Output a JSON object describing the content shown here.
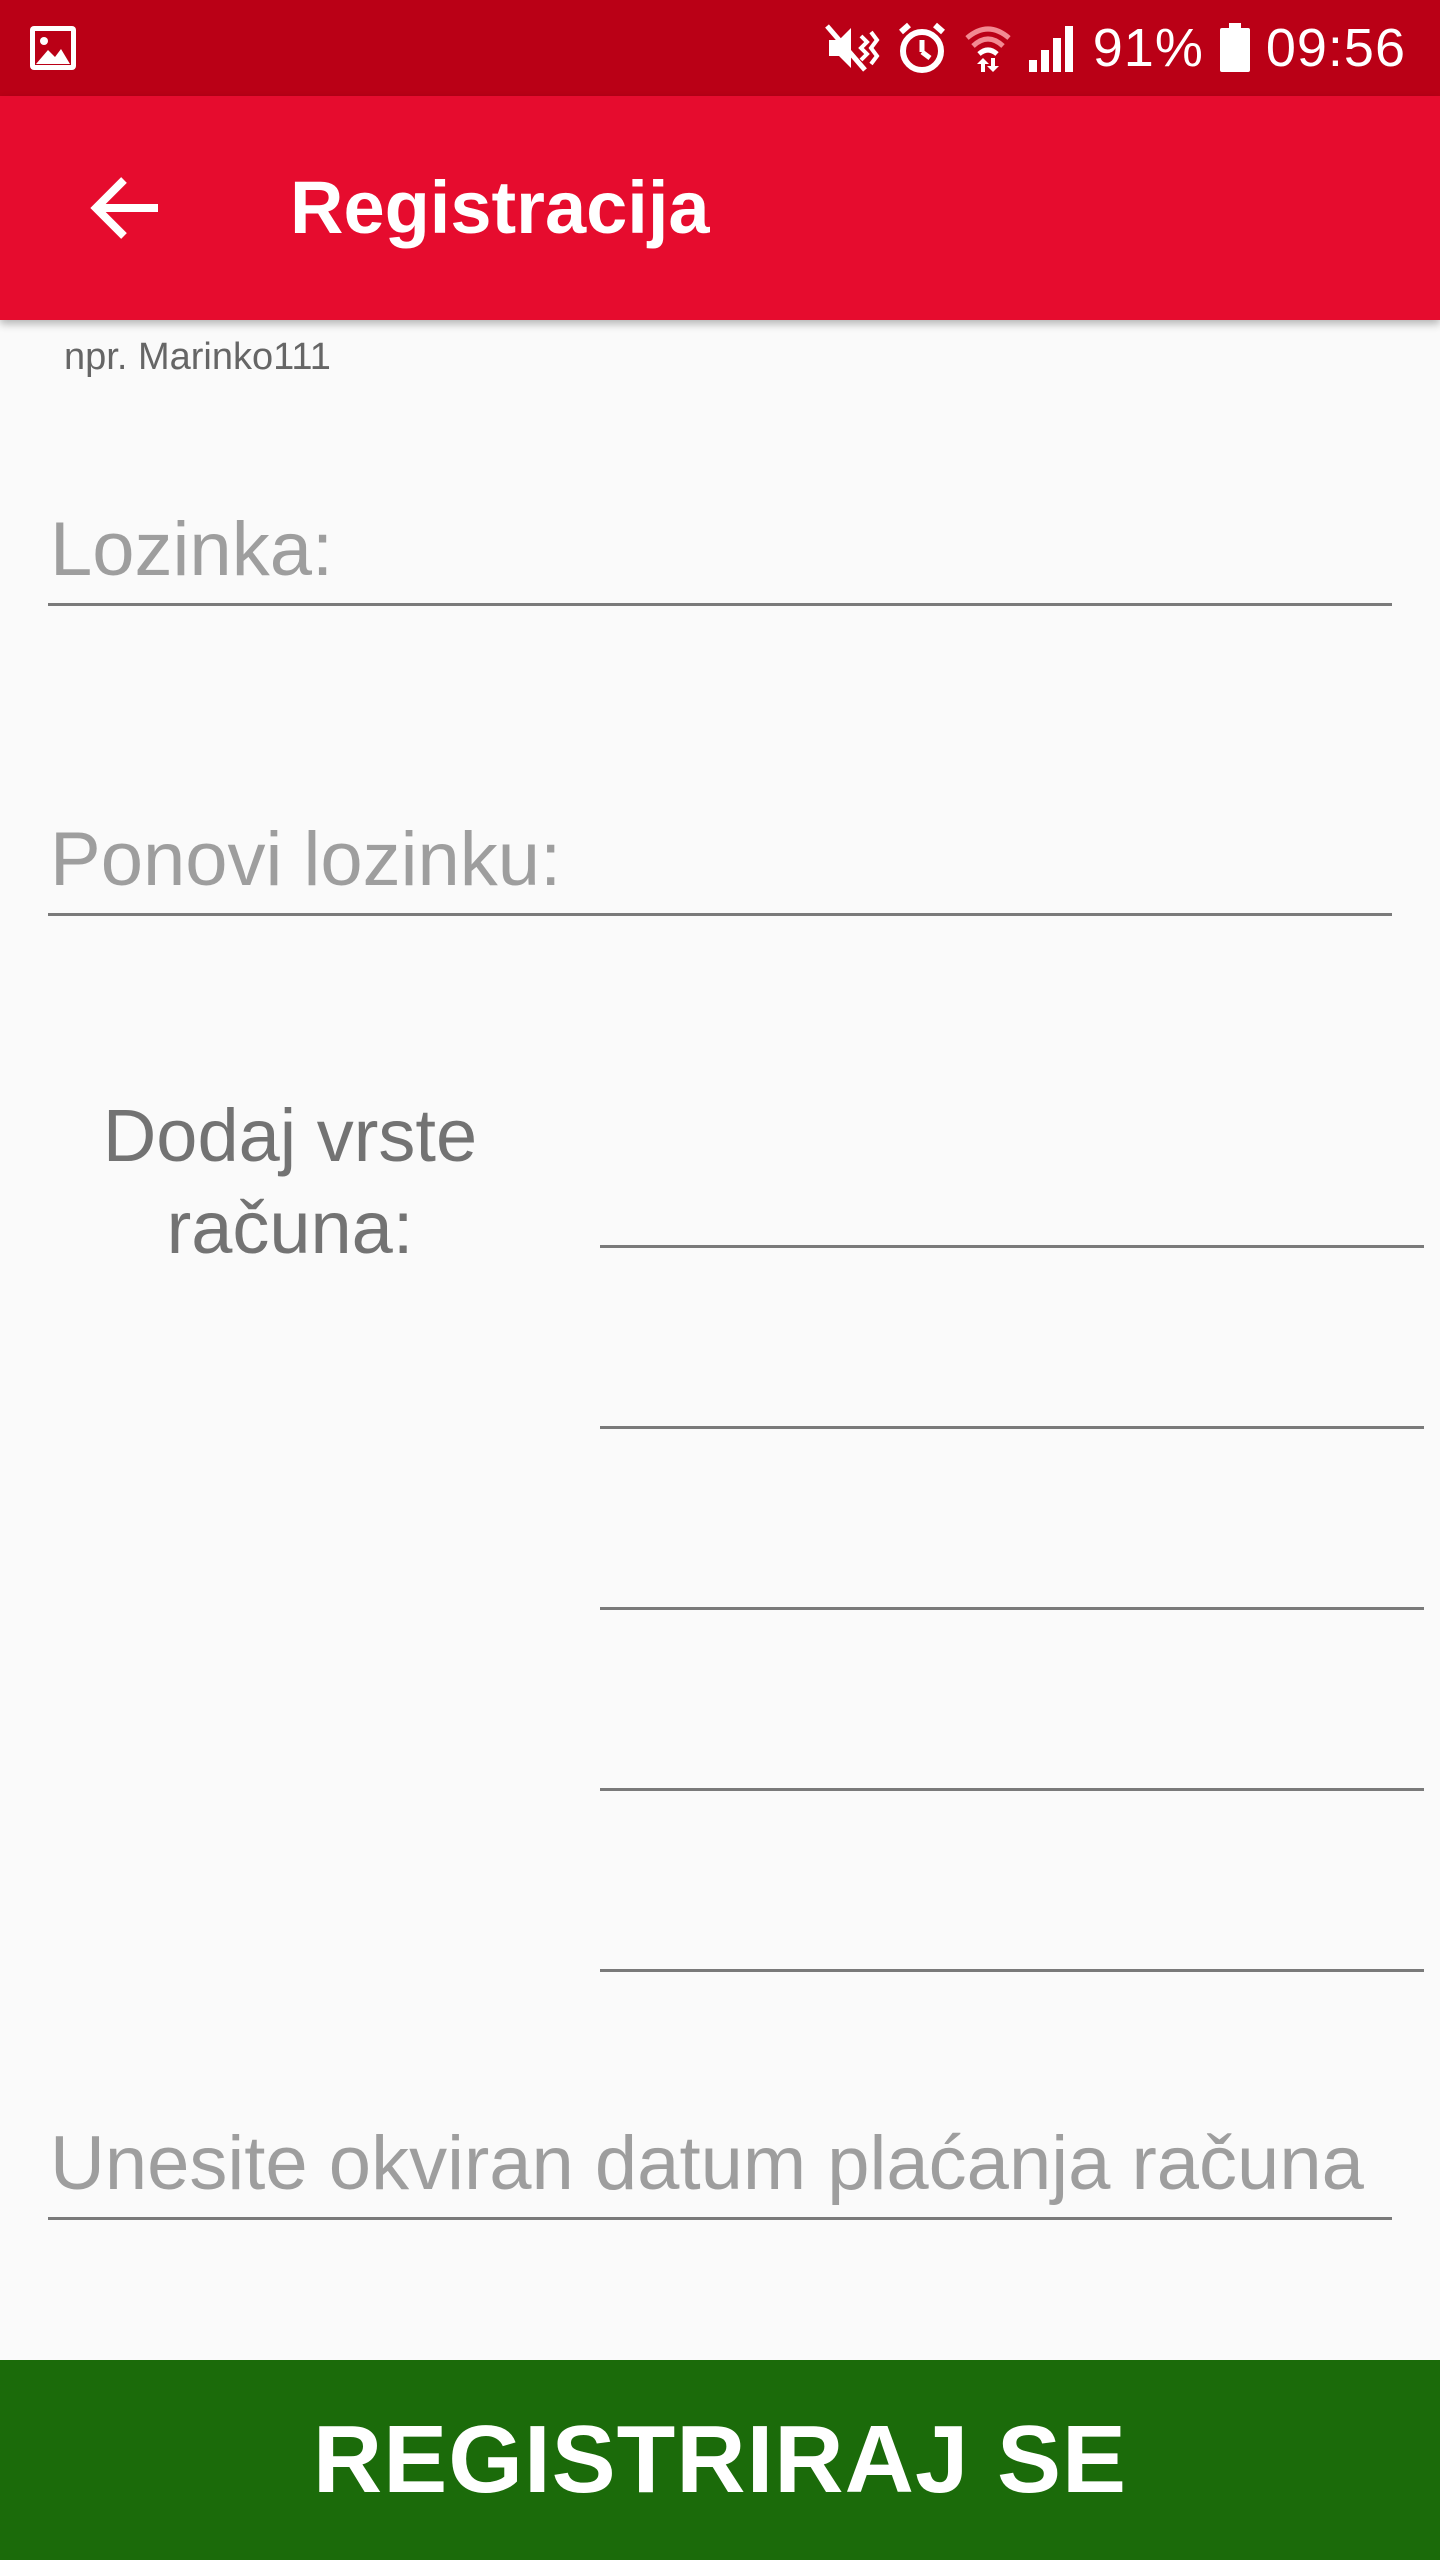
{
  "status_bar": {
    "left_icon": "image-icon",
    "right_icons": [
      "mute-vibrate-icon",
      "alarm-icon",
      "wifi-icon",
      "signal-icon",
      "battery-icon"
    ],
    "battery_text": "91%",
    "time": "09:56",
    "background_color": "#ba0016"
  },
  "toolbar": {
    "back_icon": "arrow-left-icon",
    "title": "Registracija",
    "background_color": "#e60c2e"
  },
  "form": {
    "username_hint": "npr. Marinko111",
    "password_placeholder": "Lozinka:",
    "repeat_password_placeholder": "Ponovi lozinku:",
    "bill_types_label": "Dodaj vrste računa:",
    "bill_type_fields": [
      "",
      "",
      "",
      "",
      ""
    ],
    "payment_date_placeholder": "Unesite okviran datum plaćanja računa"
  },
  "register_button": {
    "label": "REGISTRIRAJ SE",
    "background_color": "#1b6b0a"
  }
}
